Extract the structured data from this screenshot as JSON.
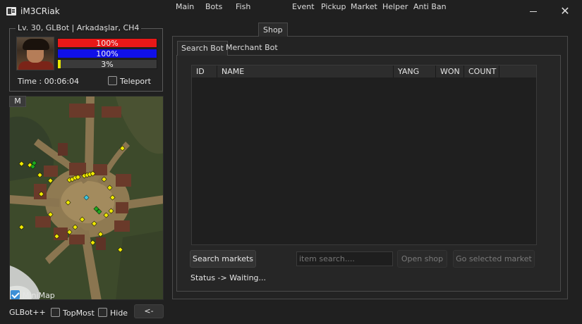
{
  "window": {
    "title": "iM3CRiak",
    "minimize_icon": "minimize-icon",
    "close_icon": "close-icon",
    "close_glyph": "✕"
  },
  "character": {
    "legend": "Lv. 30, GLBot | Arkadaşlar, CH4",
    "hp_text": "100%",
    "mp_text": "100%",
    "exp_text": "3%",
    "exp_fraction": 0.03,
    "hp_color": "#e81818",
    "mp_color": "#1010e8",
    "exp_color": "#e6e600",
    "time_label": "Time : 00:06:04",
    "teleport_label": "Teleport",
    "teleport_checked": false
  },
  "minimap": {
    "m_button": "M",
    "minimap_label": "MiniMap",
    "minimap_checked": true
  },
  "footer": {
    "app_label": "GLBot++",
    "topmost_label": "TopMost",
    "hide_label": "Hide",
    "back_button": "<-"
  },
  "tabs": [
    "Main",
    "Bots",
    "Fish",
    "Shop",
    "Event",
    "Pickup",
    "Market",
    "Helper",
    "Anti Ban"
  ],
  "active_tab": "Shop",
  "subtabs": [
    "Search Bot",
    "Merchant Bot"
  ],
  "active_subtab": "Search Bot",
  "table": {
    "columns": [
      "ID",
      "NAME",
      "YANG",
      "WON",
      "COUNT"
    ],
    "rows": []
  },
  "search": {
    "search_markets_button": "Search markets",
    "item_search_placeholder": "item search....",
    "open_shop_button": "Open shop",
    "go_selected_market_button": "Go selected market",
    "status_text": "Status -> Waiting..."
  },
  "colors": {
    "accent": "#3d8fd6",
    "background": "#202020"
  }
}
